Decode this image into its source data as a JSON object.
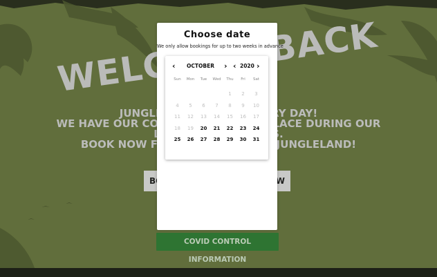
{
  "background": {
    "hero_title": "WELCOME BACK",
    "hero_lines": [
      "JUNGLELAND IS OPEN EVERY DAY!",
      "WE HAVE OUR COVID CONTROLS IN PLACE DURING OUR",
      "LIMITED OPERATIONS.",
      "BOOK NOW FOR A SAFE VISIT TO JUNGLELAND!"
    ],
    "book_button_left": "BOOK",
    "book_button_right": "NOW",
    "covid_button": "COVID CONTROL INFORMATION",
    "colors": {
      "bg": "#66733f",
      "covid_green": "#2f7a35"
    }
  },
  "modal": {
    "title": "Choose date",
    "subtitle": "We only allow bookings for up to two weeks in advance"
  },
  "calendar": {
    "month": "OCTOBER",
    "year": "2020",
    "weekdays": [
      "Sun",
      "Mon",
      "Tue",
      "Wed",
      "Thu",
      "Fri",
      "Sat"
    ],
    "weeks": [
      [
        null,
        null,
        null,
        null,
        {
          "d": "1",
          "on": false
        },
        {
          "d": "2",
          "on": false
        },
        {
          "d": "3",
          "on": false
        }
      ],
      [
        {
          "d": "4",
          "on": false
        },
        {
          "d": "5",
          "on": false
        },
        {
          "d": "6",
          "on": false
        },
        {
          "d": "7",
          "on": false
        },
        {
          "d": "8",
          "on": false
        },
        {
          "d": "9",
          "on": false
        },
        {
          "d": "10",
          "on": false
        }
      ],
      [
        {
          "d": "11",
          "on": false
        },
        {
          "d": "12",
          "on": false
        },
        {
          "d": "13",
          "on": false
        },
        {
          "d": "14",
          "on": false
        },
        {
          "d": "15",
          "on": false
        },
        {
          "d": "16",
          "on": false
        },
        {
          "d": "17",
          "on": false
        }
      ],
      [
        {
          "d": "18",
          "on": false
        },
        {
          "d": "19",
          "on": false
        },
        {
          "d": "20",
          "on": true
        },
        {
          "d": "21",
          "on": true
        },
        {
          "d": "22",
          "on": true
        },
        {
          "d": "23",
          "on": true
        },
        {
          "d": "24",
          "on": true
        }
      ],
      [
        {
          "d": "25",
          "on": true
        },
        {
          "d": "26",
          "on": true
        },
        {
          "d": "27",
          "on": true
        },
        {
          "d": "28",
          "on": true
        },
        {
          "d": "29",
          "on": true
        },
        {
          "d": "30",
          "on": true
        },
        {
          "d": "31",
          "on": true
        }
      ]
    ],
    "icons": {
      "prev_month": "chevron-left-icon",
      "next_month": "chevron-right-icon",
      "prev_year": "chevron-left-icon",
      "next_year": "chevron-right-icon"
    }
  }
}
